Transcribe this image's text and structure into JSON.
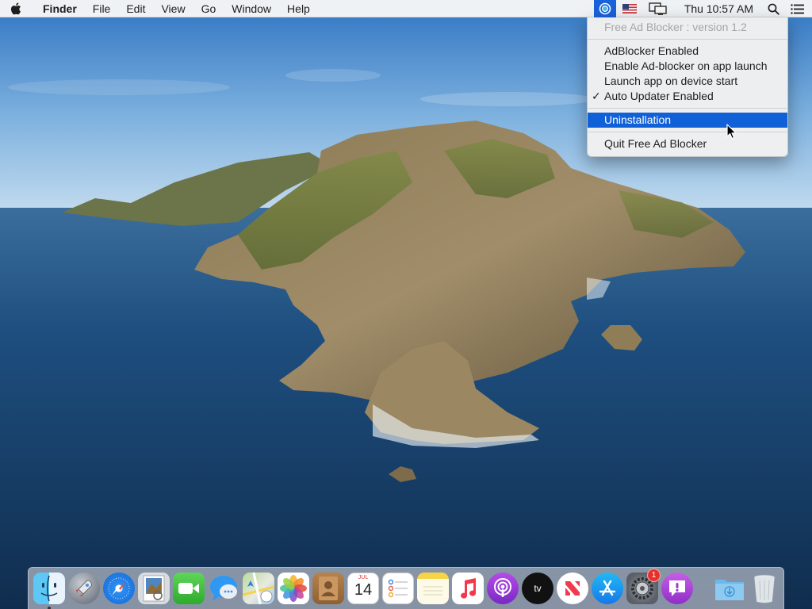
{
  "menubar": {
    "app_name": "Finder",
    "menus": [
      "File",
      "Edit",
      "View",
      "Go",
      "Window",
      "Help"
    ],
    "clock": "Thu 10:57 AM",
    "status_icons": [
      "adblocker-status-icon",
      "us-flag-input-icon",
      "display-mirroring-icon",
      "spotlight-search-icon",
      "notification-center-icon"
    ]
  },
  "dropdown": {
    "header": "Free Ad Blocker : version 1.2",
    "items": [
      {
        "label": "AdBlocker Enabled",
        "checked": false
      },
      {
        "label": "Enable Ad-blocker on app launch",
        "checked": false
      },
      {
        "label": "Launch app on device start",
        "checked": false
      },
      {
        "label": "Auto Updater Enabled",
        "checked": true
      }
    ],
    "check_mark": "✓",
    "highlighted": "Uninstallation",
    "quit": "Quit Free Ad Blocker"
  },
  "dock": {
    "apps": [
      {
        "name": "Finder",
        "icon": "finder-icon",
        "running": true
      },
      {
        "name": "Launchpad",
        "icon": "launchpad-icon"
      },
      {
        "name": "Safari",
        "icon": "safari-icon"
      },
      {
        "name": "Preview",
        "icon": "preview-icon"
      },
      {
        "name": "FaceTime",
        "icon": "facetime-icon"
      },
      {
        "name": "Messages",
        "icon": "messages-icon"
      },
      {
        "name": "Maps",
        "icon": "maps-icon"
      },
      {
        "name": "Photos",
        "icon": "photos-icon"
      },
      {
        "name": "Contacts",
        "icon": "contacts-icon"
      },
      {
        "name": "Calendar",
        "icon": "calendar-icon",
        "month": "JUL",
        "day": "14"
      },
      {
        "name": "Reminders",
        "icon": "reminders-icon"
      },
      {
        "name": "Notes",
        "icon": "notes-icon"
      },
      {
        "name": "Music",
        "icon": "music-icon"
      },
      {
        "name": "Podcasts",
        "icon": "podcasts-icon"
      },
      {
        "name": "TV",
        "icon": "tv-icon",
        "label": "tv"
      },
      {
        "name": "News",
        "icon": "news-icon"
      },
      {
        "name": "App Store",
        "icon": "app-store-icon"
      },
      {
        "name": "System Preferences",
        "icon": "system-preferences-icon",
        "badge": "1"
      },
      {
        "name": "Feedback Assistant",
        "icon": "feedback-assistant-icon"
      },
      {
        "name": "Downloads",
        "icon": "downloads-folder-icon"
      },
      {
        "name": "Trash",
        "icon": "trash-icon"
      }
    ]
  },
  "colors": {
    "menu_highlight": "#1060d8",
    "status_active": "#1a62db",
    "badge": "#e8302b"
  }
}
